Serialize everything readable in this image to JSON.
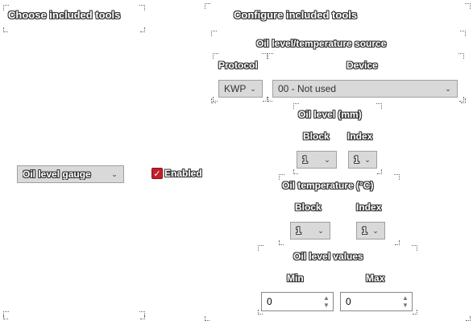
{
  "left_panel": {
    "title": "Choose included tools",
    "tool_select": {
      "value": "Oil level gauge"
    },
    "enabled_checkbox": {
      "label": "Enabled",
      "checked": true
    }
  },
  "right_panel": {
    "title": "Configure included tools",
    "source_group": {
      "title": "Oil level/temperature source",
      "protocol_label": "Protocol",
      "protocol_value": "KWP",
      "device_label": "Device",
      "device_value": "00 - Not used"
    },
    "oil_level_group": {
      "title": "Oil level (mm)",
      "block_label": "Block",
      "block_value": "1",
      "index_label": "Index",
      "index_value": "1"
    },
    "oil_temp_group": {
      "title": "Oil temperature (°C)",
      "block_label": "Block",
      "block_value": "1",
      "index_label": "Index",
      "index_value": "1"
    },
    "values_group": {
      "title": "Oil level values",
      "min_label": "Min",
      "min_value": "0",
      "max_label": "Max",
      "max_value": "0"
    }
  },
  "colors": {
    "checkbox": "#c0202a",
    "select_bg": "#d9d9d9"
  },
  "icons": {
    "dropdown": "chevron-down-icon",
    "checkbox": "checkmark-icon",
    "spin": "spin-arrows-icon"
  }
}
